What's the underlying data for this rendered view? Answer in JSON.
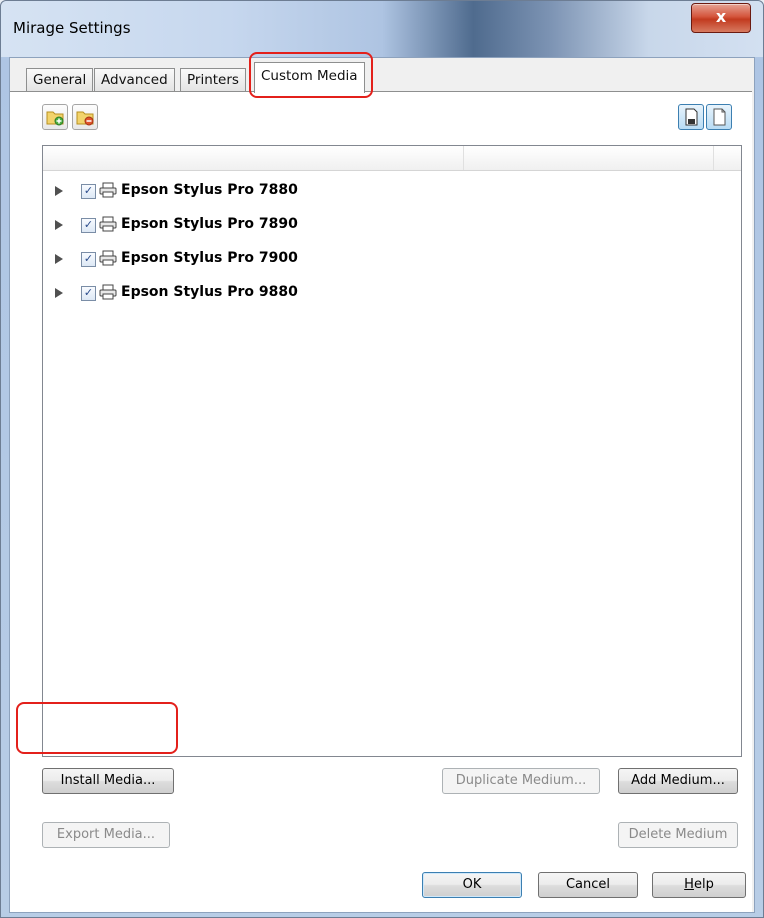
{
  "window": {
    "title": "Mirage Settings",
    "close_glyph": "x"
  },
  "tabs": [
    {
      "label": "General"
    },
    {
      "label": "Advanced"
    },
    {
      "label": "Printers"
    },
    {
      "label": "Custom Media"
    }
  ],
  "toolbar": {
    "left": [
      {
        "icon": "folder-add-icon"
      },
      {
        "icon": "folder-remove-icon"
      }
    ],
    "right": [
      {
        "icon": "page-filled-icon"
      },
      {
        "icon": "page-blank-icon"
      }
    ]
  },
  "tree": {
    "items": [
      {
        "label": "Epson Stylus Pro 7880",
        "checked": true
      },
      {
        "label": "Epson Stylus Pro 7890",
        "checked": true
      },
      {
        "label": "Epson Stylus Pro 7900",
        "checked": true
      },
      {
        "label": "Epson Stylus Pro 9880",
        "checked": true
      }
    ],
    "check_glyph": "✓"
  },
  "buttons": {
    "install_media": "Install Media...",
    "duplicate_medium": "Duplicate Medium...",
    "add_medium": "Add Medium...",
    "export_media": "Export Media...",
    "delete_medium": "Delete Medium",
    "ok": "OK",
    "cancel": "Cancel",
    "help_accel": "H",
    "help_rest": "elp"
  },
  "colors": {
    "highlight_outline": "#e3201b",
    "default_button_border": "#3c7fb1"
  }
}
